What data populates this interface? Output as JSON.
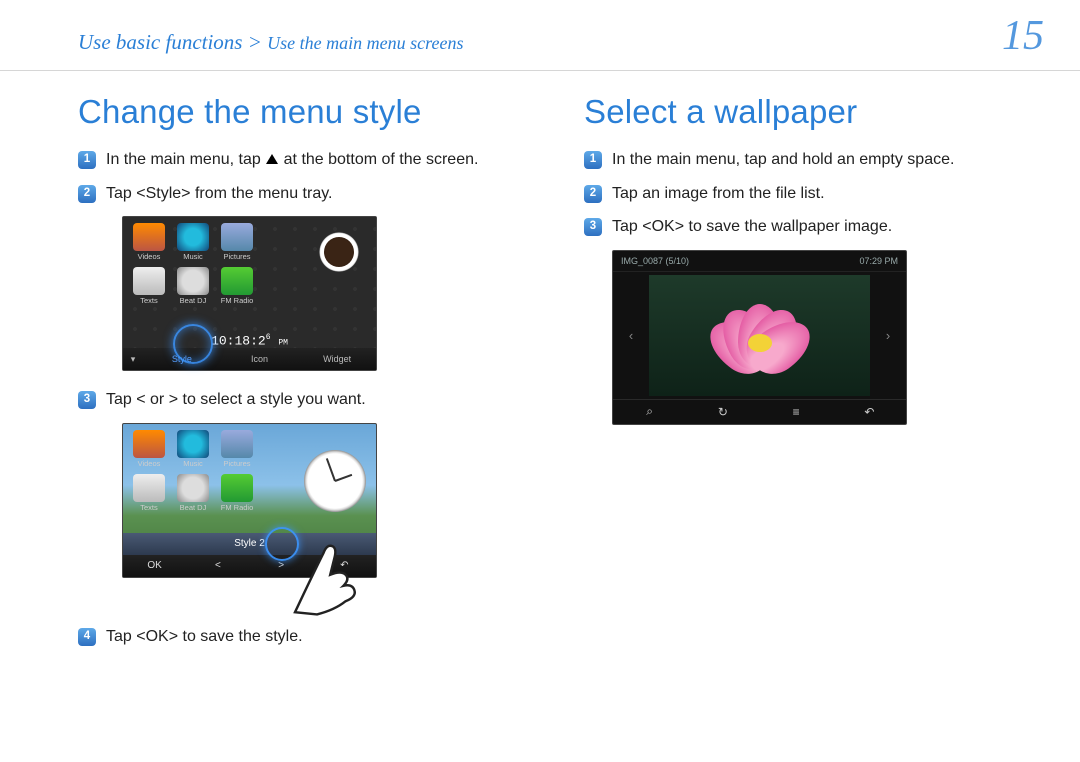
{
  "header": {
    "breadcrumb_main": "Use basic functions",
    "breadcrumb_sep": " > ",
    "breadcrumb_sub": "Use the main menu screens",
    "page_number": "15"
  },
  "left": {
    "title": "Change the menu style",
    "step1_a": "In the main menu, tap ",
    "step1_b": " at the bottom of the screen.",
    "step2": "Tap <Style> from the menu tray.",
    "step3": "Tap < or > to select a style you want.",
    "step4": "Tap <OK> to save the style."
  },
  "right": {
    "title": "Select a wallpaper",
    "step1": "In the main menu, tap and hold an empty space.",
    "step2": "Tap an image from the file list.",
    "step3": "Tap <OK> to save the wallpaper image."
  },
  "device1": {
    "icons": [
      "Videos",
      "Music",
      "Pictures",
      "Texts",
      "Beat DJ",
      "FM Radio"
    ],
    "clock": "10:18:2",
    "clock_small": "6",
    "clock_suffix": "PM",
    "tray": [
      "Style",
      "Icon",
      "Widget"
    ]
  },
  "device2": {
    "icons": [
      "Videos",
      "Music",
      "Pictures",
      "Texts",
      "Beat DJ",
      "FM Radio"
    ],
    "style_label": "Style 2",
    "bottom": {
      "ok": "OK",
      "left": "<",
      "right": ">",
      "back": "↶"
    }
  },
  "device3": {
    "filename": "IMG_0087  (5/10)",
    "time": "07:29 PM",
    "nav": {
      "left": "‹",
      "right": "›"
    },
    "bottom": {
      "search": "⌕",
      "rotate": "↻",
      "menu": "≡",
      "back": "↶"
    }
  }
}
